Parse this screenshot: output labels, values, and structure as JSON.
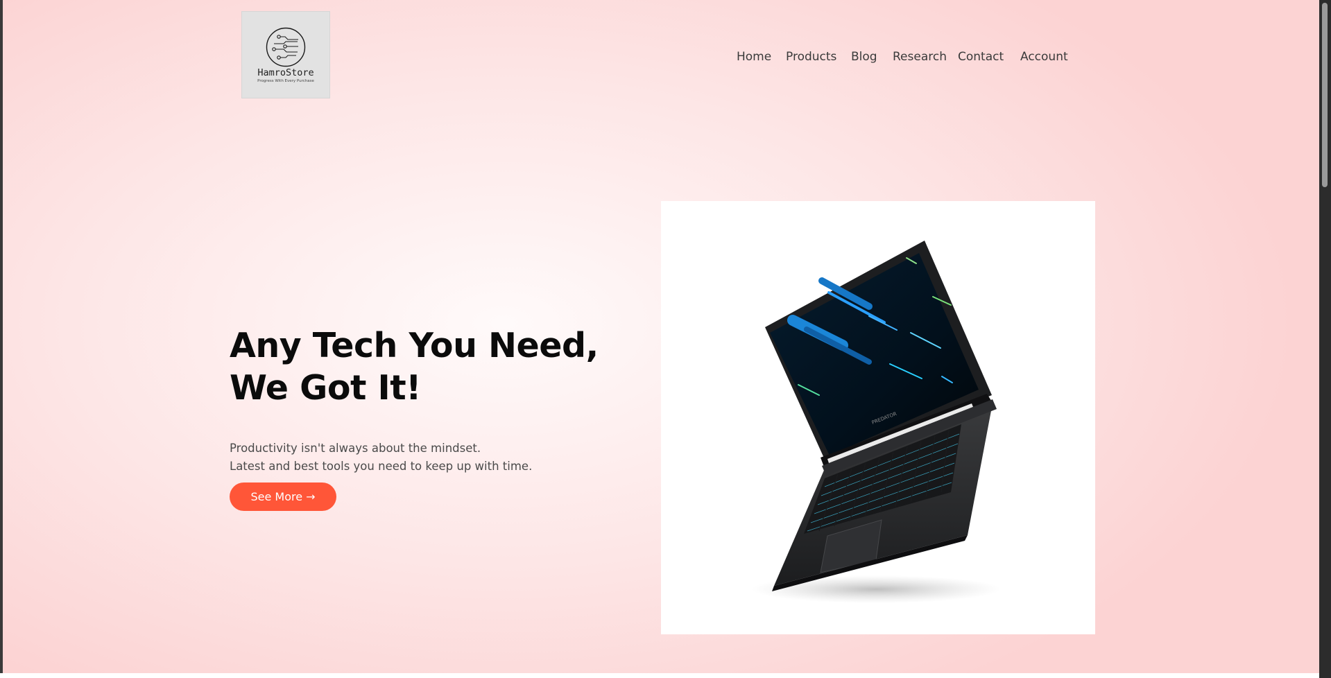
{
  "brand": {
    "name": "HamroStore",
    "tagline": "Progress With Every Purchase"
  },
  "nav": {
    "items": [
      "Home",
      "Products",
      "Blog",
      "Research",
      "Contact",
      "Account"
    ]
  },
  "hero": {
    "title_line1": "Any Tech You Need,",
    "title_line2": "We Got It!",
    "subtitle_line1": "Productivity isn't always about the mindset.",
    "subtitle_line2": "Latest and best tools you need to keep up with time.",
    "cta_label": "See More →"
  },
  "product": {
    "icon": "laptop-image",
    "screen_label": "PREDATOR"
  },
  "colors": {
    "accent": "#ff5638",
    "background": "#fde6e6",
    "heading": "#0b0b0b"
  }
}
